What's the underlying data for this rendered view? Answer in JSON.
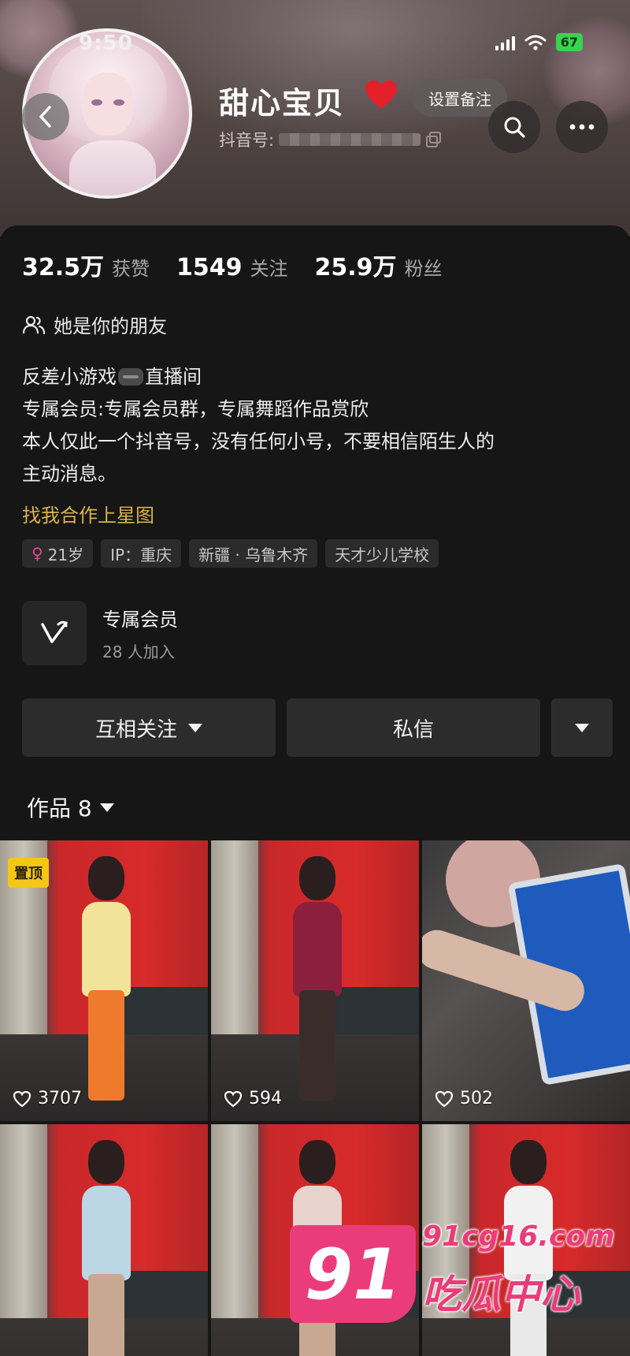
{
  "status_bar": {
    "time": "9:50",
    "battery": "67"
  },
  "header": {
    "name": "甜心宝贝",
    "heart": "❤️",
    "remark_button": "设置备注",
    "douyin_id_label": "抖音号:"
  },
  "stats": [
    {
      "value": "32.5万",
      "label": "获赞"
    },
    {
      "value": "1549",
      "label": "关注"
    },
    {
      "value": "25.9万",
      "label": "粉丝"
    }
  ],
  "relation": "她是你的朋友",
  "bio": {
    "line1_before": "反差小游戏",
    "line1_after": "直播间",
    "line2": "专属会员:专属会员群，专属舞蹈作品赏欣",
    "line3": "本人仅此一个抖音号，没有任何小号，不要相信陌生人的",
    "line4": "主动消息。"
  },
  "star_link": "找我合作上星图",
  "tags": [
    {
      "symbol": "♀",
      "text": "21岁"
    },
    {
      "text": "IP：重庆"
    },
    {
      "text": "新疆 · 乌鲁木齐"
    },
    {
      "text": "天才少儿学校"
    }
  ],
  "member": {
    "title": "专属会员",
    "subtitle": "28 人加入"
  },
  "actions": {
    "follow": "互相关注",
    "message": "私信"
  },
  "works_tab": "作品 8",
  "videos": [
    {
      "pinned_label": "置顶",
      "likes": "3707"
    },
    {
      "likes": "594"
    },
    {
      "likes": "502"
    },
    {
      "likes": ""
    },
    {
      "likes": ""
    },
    {
      "likes": ""
    }
  ],
  "watermark": {
    "number": "91",
    "domain": "91cg16.com",
    "text": "吃瓜中心"
  },
  "colors": {
    "accent_gold": "#d9b44a",
    "pin_yellow": "#f5c518",
    "female_pink": "#e04b8d",
    "watermark_pink": "#ea3c78"
  }
}
